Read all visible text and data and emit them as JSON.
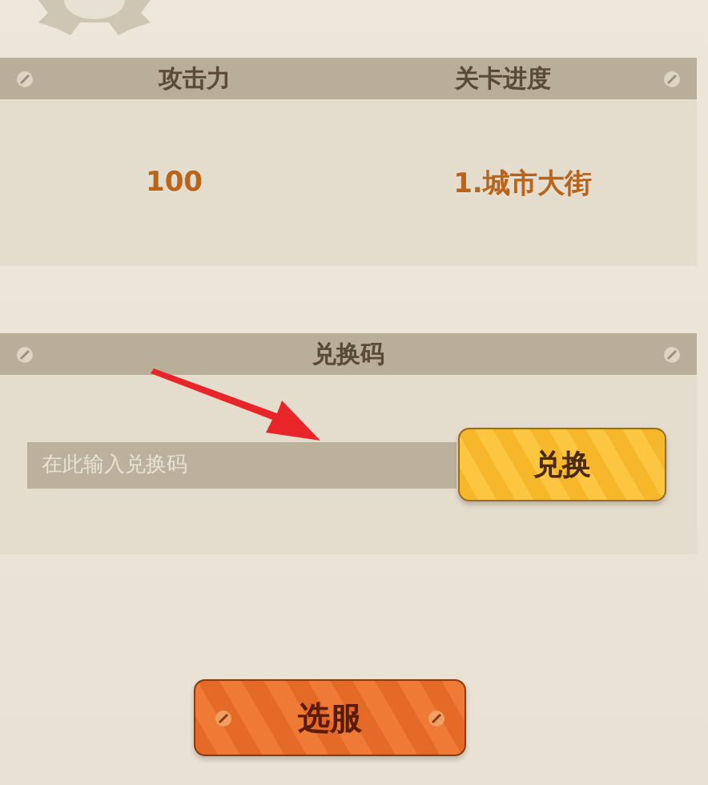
{
  "stats": {
    "columns": [
      {
        "header": "攻击力",
        "value": "100"
      },
      {
        "header": "关卡进度",
        "value": "1.城市大街"
      }
    ]
  },
  "redeem": {
    "title": "兑换码",
    "placeholder": "在此输入兑换码",
    "button": "兑换"
  },
  "server_button": "选服"
}
